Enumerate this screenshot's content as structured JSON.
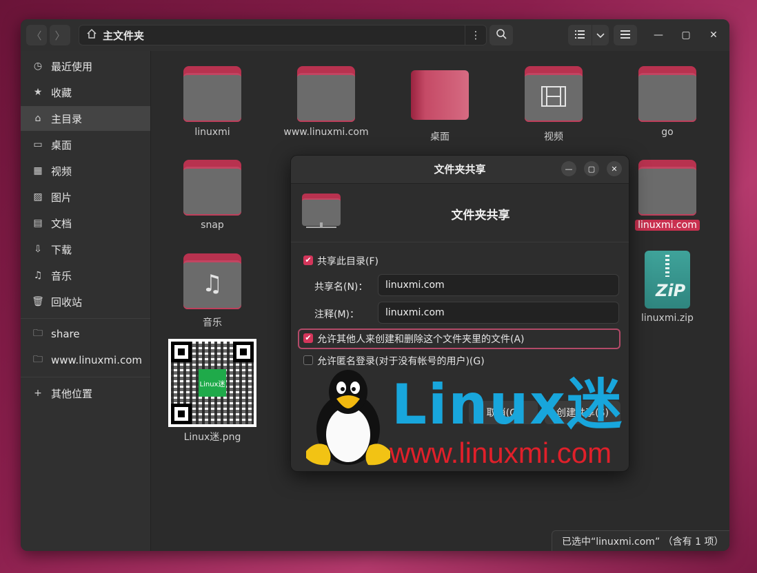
{
  "window": {
    "title": "主文件夹",
    "nav": {
      "back_glyph": "〈",
      "forward_glyph": "〉"
    },
    "icons": [
      "home-icon",
      "kebab-menu-icon",
      "search-icon",
      "list-view-icon",
      "chevron-down-icon",
      "hamburger-menu-icon",
      "minimize-icon",
      "maximize-icon",
      "close-icon"
    ]
  },
  "sidebar": {
    "items": [
      {
        "label": "最近使用",
        "icon": "clock-icon"
      },
      {
        "label": "收藏",
        "icon": "star-icon"
      },
      {
        "label": "主目录",
        "icon": "home-icon",
        "active": true
      },
      {
        "label": "桌面",
        "icon": "desktop-icon"
      },
      {
        "label": "视频",
        "icon": "film-icon"
      },
      {
        "label": "图片",
        "icon": "image-icon"
      },
      {
        "label": "文档",
        "icon": "document-icon"
      },
      {
        "label": "下载",
        "icon": "download-icon"
      },
      {
        "label": "音乐",
        "icon": "music-icon"
      },
      {
        "label": "回收站",
        "icon": "trash-icon"
      }
    ],
    "places": [
      {
        "label": "share",
        "icon": "folder-icon"
      },
      {
        "label": "www.linuxmi.com",
        "icon": "folder-icon"
      }
    ],
    "other": {
      "label": "其他位置",
      "icon": "plus-icon"
    }
  },
  "files": [
    {
      "name": "linuxmi",
      "type": "folder"
    },
    {
      "name": "www.linuxmi.com",
      "type": "folder"
    },
    {
      "name": "桌面",
      "type": "desktop"
    },
    {
      "name": "视频",
      "type": "folder-video"
    },
    {
      "name": "go",
      "type": "folder"
    },
    {
      "name": "snap",
      "type": "folder"
    },
    {
      "name": "linuxmi.com",
      "type": "folder",
      "selected": true
    },
    {
      "name": "音乐",
      "type": "folder-music"
    },
    {
      "name": "linuxmi.zip",
      "type": "zip",
      "badge": "ZiP"
    },
    {
      "name": "Linux迷.png",
      "type": "image",
      "qr_text": "Linux迷"
    }
  ],
  "statusbar": {
    "text": "已选中“linuxmi.com” （含有 1 项）"
  },
  "dialog": {
    "title": "文件夹共享",
    "heading": "文件夹共享",
    "share_checkbox": {
      "label": "共享此目录(F)",
      "checked": true
    },
    "share_name": {
      "label": "共享名(N)：",
      "value": "linuxmi.com"
    },
    "comment": {
      "label": "注释(M)：",
      "value": "linuxmi.com"
    },
    "allow_write": {
      "label": "允许其他人来创建和删除这个文件夹里的文件(A)",
      "checked": true
    },
    "allow_guest": {
      "label": "允许匿名登录(对于没有帐号的用户)(G)",
      "checked": false
    },
    "buttons": {
      "cancel": "取消(C)",
      "create": "创建共享(S)"
    }
  },
  "watermark": {
    "main": "Linux迷",
    "sub": "www.linuxmi.com"
  },
  "colors": {
    "accent": "#c9304f",
    "folder_tab": "#b8324f",
    "folder_body": "#6b6b6b",
    "brand_blue": "#18a6dc",
    "brand_red": "#e0202a"
  }
}
